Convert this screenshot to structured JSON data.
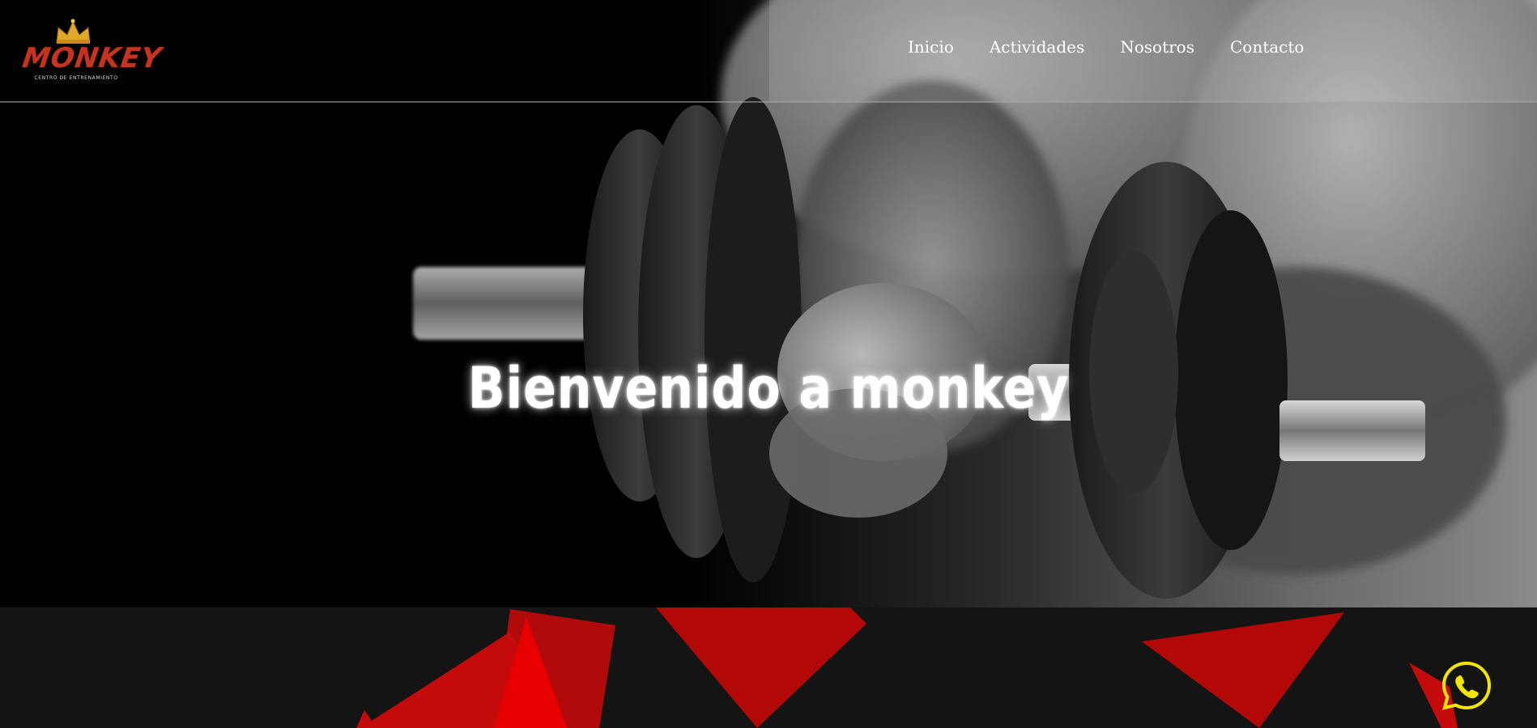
{
  "brand": {
    "logo_name": "MONKEY",
    "logo_tagline": "CENTRO DE ENTRENAMIENTO"
  },
  "nav": {
    "items": [
      {
        "label": "Inicio"
      },
      {
        "label": "Actividades"
      },
      {
        "label": "Nosotros"
      },
      {
        "label": "Contacto"
      }
    ]
  },
  "hero": {
    "title": "Bienvenido a monkey",
    "image_subject": "dumbbell-grip-photo"
  },
  "icons": {
    "logo_crown": "crown-icon",
    "whatsapp": "whatsapp-icon"
  },
  "colors": {
    "accent_red": "#b30a0a",
    "bright_red": "#e00000",
    "whatsapp_yellow": "#f2e600",
    "bottom_bg": "#141414",
    "logo_red": "#c6331f",
    "logo_gold": "#e0a828"
  }
}
